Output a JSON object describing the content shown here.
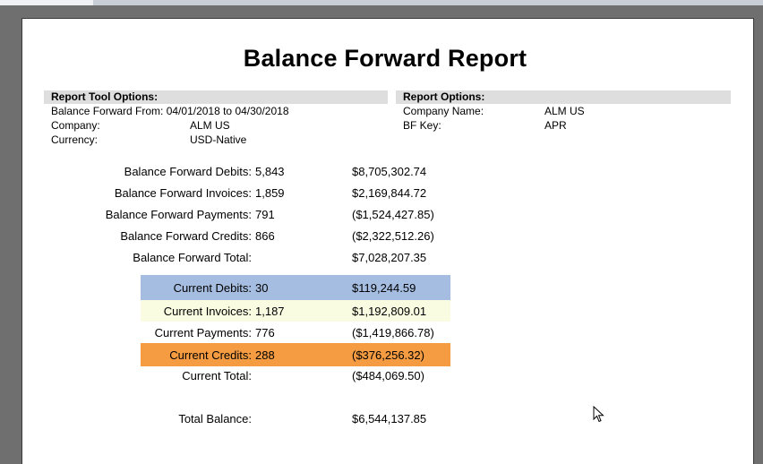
{
  "report": {
    "title": "Balance Forward Report",
    "tool_options": {
      "header": "Report Tool Options:",
      "bf_from": "Balance Forward From: 04/01/2018 to 04/30/2018",
      "company_label": "Company:",
      "company_value": "ALM US",
      "currency_label": "Currency:",
      "currency_value": "USD-Native"
    },
    "report_options": {
      "header": "Report Options:",
      "company_name_label": "Company Name:",
      "company_name_value": "ALM US",
      "bf_key_label": "BF Key:",
      "bf_key_value": "APR"
    },
    "balance_forward": [
      {
        "label": "Balance Forward Debits:",
        "count": "5,843",
        "amount": "$8,705,302.74"
      },
      {
        "label": "Balance Forward Invoices:",
        "count": "1,859",
        "amount": "$2,169,844.72"
      },
      {
        "label": "Balance Forward Payments:",
        "count": "791",
        "amount": "($1,524,427.85)"
      },
      {
        "label": "Balance Forward Credits:",
        "count": "866",
        "amount": "($2,322,512.26)"
      },
      {
        "label": "Balance Forward Total:",
        "count": "",
        "amount": "$7,028,207.35"
      }
    ],
    "current": [
      {
        "label": "Current Debits:",
        "count": "30",
        "amount": "$119,244.59",
        "highlight": "#a5bde0"
      },
      {
        "label": "Current Invoices:",
        "count": "1,187",
        "amount": "$1,192,809.01",
        "highlight": "#f9fce0"
      },
      {
        "label": "Current Payments:",
        "count": "776",
        "amount": "($1,419,866.78)",
        "highlight": ""
      },
      {
        "label": "Current Credits:",
        "count": "288",
        "amount": "($376,256.32)",
        "highlight": "#f59c42"
      },
      {
        "label": "Current Total:",
        "count": "",
        "amount": "($484,069.50)",
        "highlight": ""
      }
    ],
    "total_balance": {
      "label": "Total Balance:",
      "amount": "$6,544,137.85"
    }
  }
}
